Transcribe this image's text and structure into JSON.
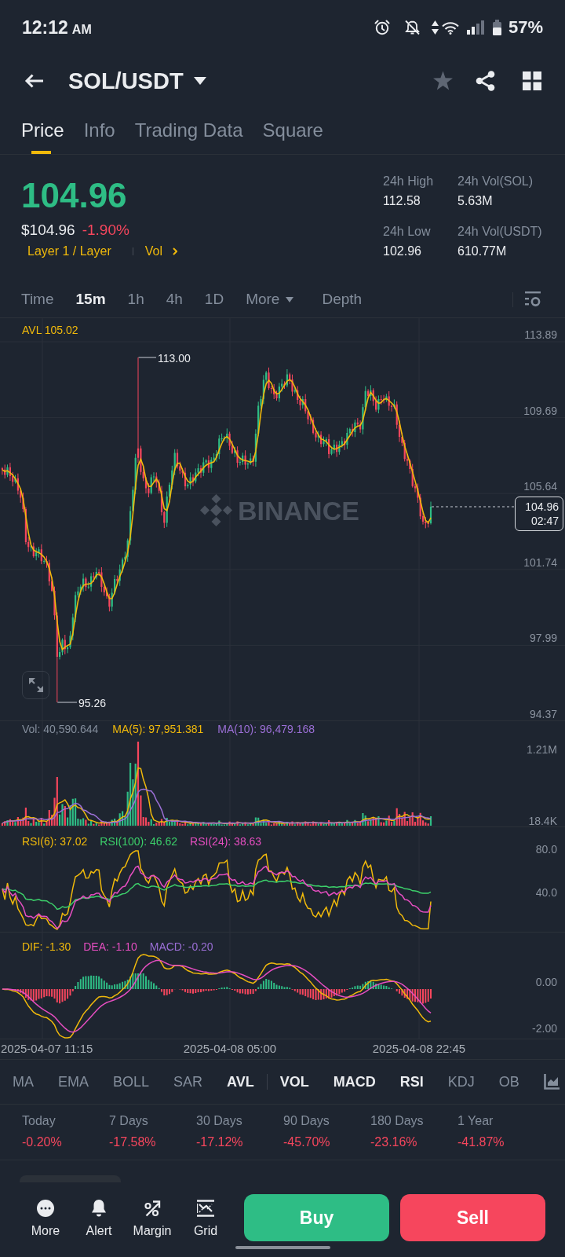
{
  "status_bar": {
    "time": "12:12",
    "meridiem": "AM",
    "battery": "57%"
  },
  "header": {
    "pair": "SOL/USDT",
    "favorite": false
  },
  "tabs": [
    {
      "label": "Price",
      "selected": true
    },
    {
      "label": "Info",
      "selected": false
    },
    {
      "label": "Trading Data",
      "selected": false
    },
    {
      "label": "Square",
      "selected": false
    }
  ],
  "ticker": {
    "last_price": "104.96",
    "price_rising": true,
    "usd_price": "$104.96",
    "change": "-1.90%",
    "change_rising": false,
    "category": "Layer 1 / Layer",
    "vol_link": "Vol",
    "stats": [
      {
        "label": "24h High",
        "value": "112.58"
      },
      {
        "label": "24h Vol(SOL)",
        "value": "5.63M"
      },
      {
        "label": "24h Low",
        "value": "102.96"
      },
      {
        "label": "24h Vol(USDT)",
        "value": "610.77M"
      }
    ]
  },
  "intervals": [
    {
      "label": "Time",
      "kind": "option",
      "selected": false
    },
    {
      "label": "15m",
      "kind": "option",
      "selected": true
    },
    {
      "label": "1h",
      "kind": "option",
      "selected": false
    },
    {
      "label": "4h",
      "kind": "option",
      "selected": false
    },
    {
      "label": "1D",
      "kind": "option",
      "selected": false
    },
    {
      "label": "More",
      "kind": "dropdown",
      "selected": false
    },
    {
      "label": "Depth",
      "kind": "option",
      "selected": false
    }
  ],
  "price_chart": {
    "avl": "AVL 105.02",
    "watermark": "BINANCE",
    "y_labels": [
      "113.89",
      "109.69",
      "105.64",
      "101.74",
      "97.99",
      "94.37"
    ],
    "high_label": "113.00",
    "low_label": "95.26",
    "last_price": "104.96",
    "countdown": "02:47"
  },
  "volume": {
    "legend": [
      {
        "text": "Vol: 40,590.644",
        "color": "#848e9c"
      },
      {
        "text": "MA(5): 97,951.381",
        "color": "#f0b90b"
      },
      {
        "text": "MA(10): 96,479.168",
        "color": "#9b6fd6"
      }
    ],
    "y_labels": [
      "1.21M",
      "18.4K"
    ]
  },
  "rsi": {
    "legend": [
      {
        "text": "RSI(6): 37.02",
        "color": "#f0b90b"
      },
      {
        "text": "RSI(100): 46.62",
        "color": "#3ccf6a"
      },
      {
        "text": "RSI(24): 38.63",
        "color": "#e64ec1"
      }
    ],
    "y_labels": [
      "80.0",
      "40.0"
    ]
  },
  "macd": {
    "legend": [
      {
        "text": "DIF: -1.30",
        "color": "#f0b90b"
      },
      {
        "text": "DEA: -1.10",
        "color": "#e64ec1"
      },
      {
        "text": "MACD: -0.20",
        "color": "#9b6fd6"
      }
    ],
    "y_labels": [
      "0.00",
      "-2.00"
    ]
  },
  "time_axis": [
    "2025-04-07 11:15",
    "2025-04-08 05:00",
    "2025-04-08 22:45"
  ],
  "indicators": {
    "main": [
      {
        "label": "MA",
        "selected": false
      },
      {
        "label": "EMA",
        "selected": false
      },
      {
        "label": "BOLL",
        "selected": false
      },
      {
        "label": "SAR",
        "selected": false
      },
      {
        "label": "AVL",
        "selected": true
      }
    ],
    "sub": [
      {
        "label": "VOL",
        "selected": true
      },
      {
        "label": "MACD",
        "selected": true
      },
      {
        "label": "RSI",
        "selected": true
      },
      {
        "label": "KDJ",
        "selected": false
      },
      {
        "label": "OB",
        "selected": false
      }
    ]
  },
  "performance": [
    {
      "label": "Today",
      "value": "-0.20%",
      "rising": false
    },
    {
      "label": "7 Days",
      "value": "-17.58%",
      "rising": false
    },
    {
      "label": "30 Days",
      "value": "-17.12%",
      "rising": false
    },
    {
      "label": "90 Days",
      "value": "-45.70%",
      "rising": false
    },
    {
      "label": "180 Days",
      "value": "-23.16%",
      "rising": false
    },
    {
      "label": "1 Year",
      "value": "-41.87%",
      "rising": false
    }
  ],
  "actions": [
    {
      "label": "More"
    },
    {
      "label": "Alert"
    },
    {
      "label": "Margin"
    },
    {
      "label": "Grid"
    }
  ],
  "buy": "Buy",
  "sell": "Sell"
}
